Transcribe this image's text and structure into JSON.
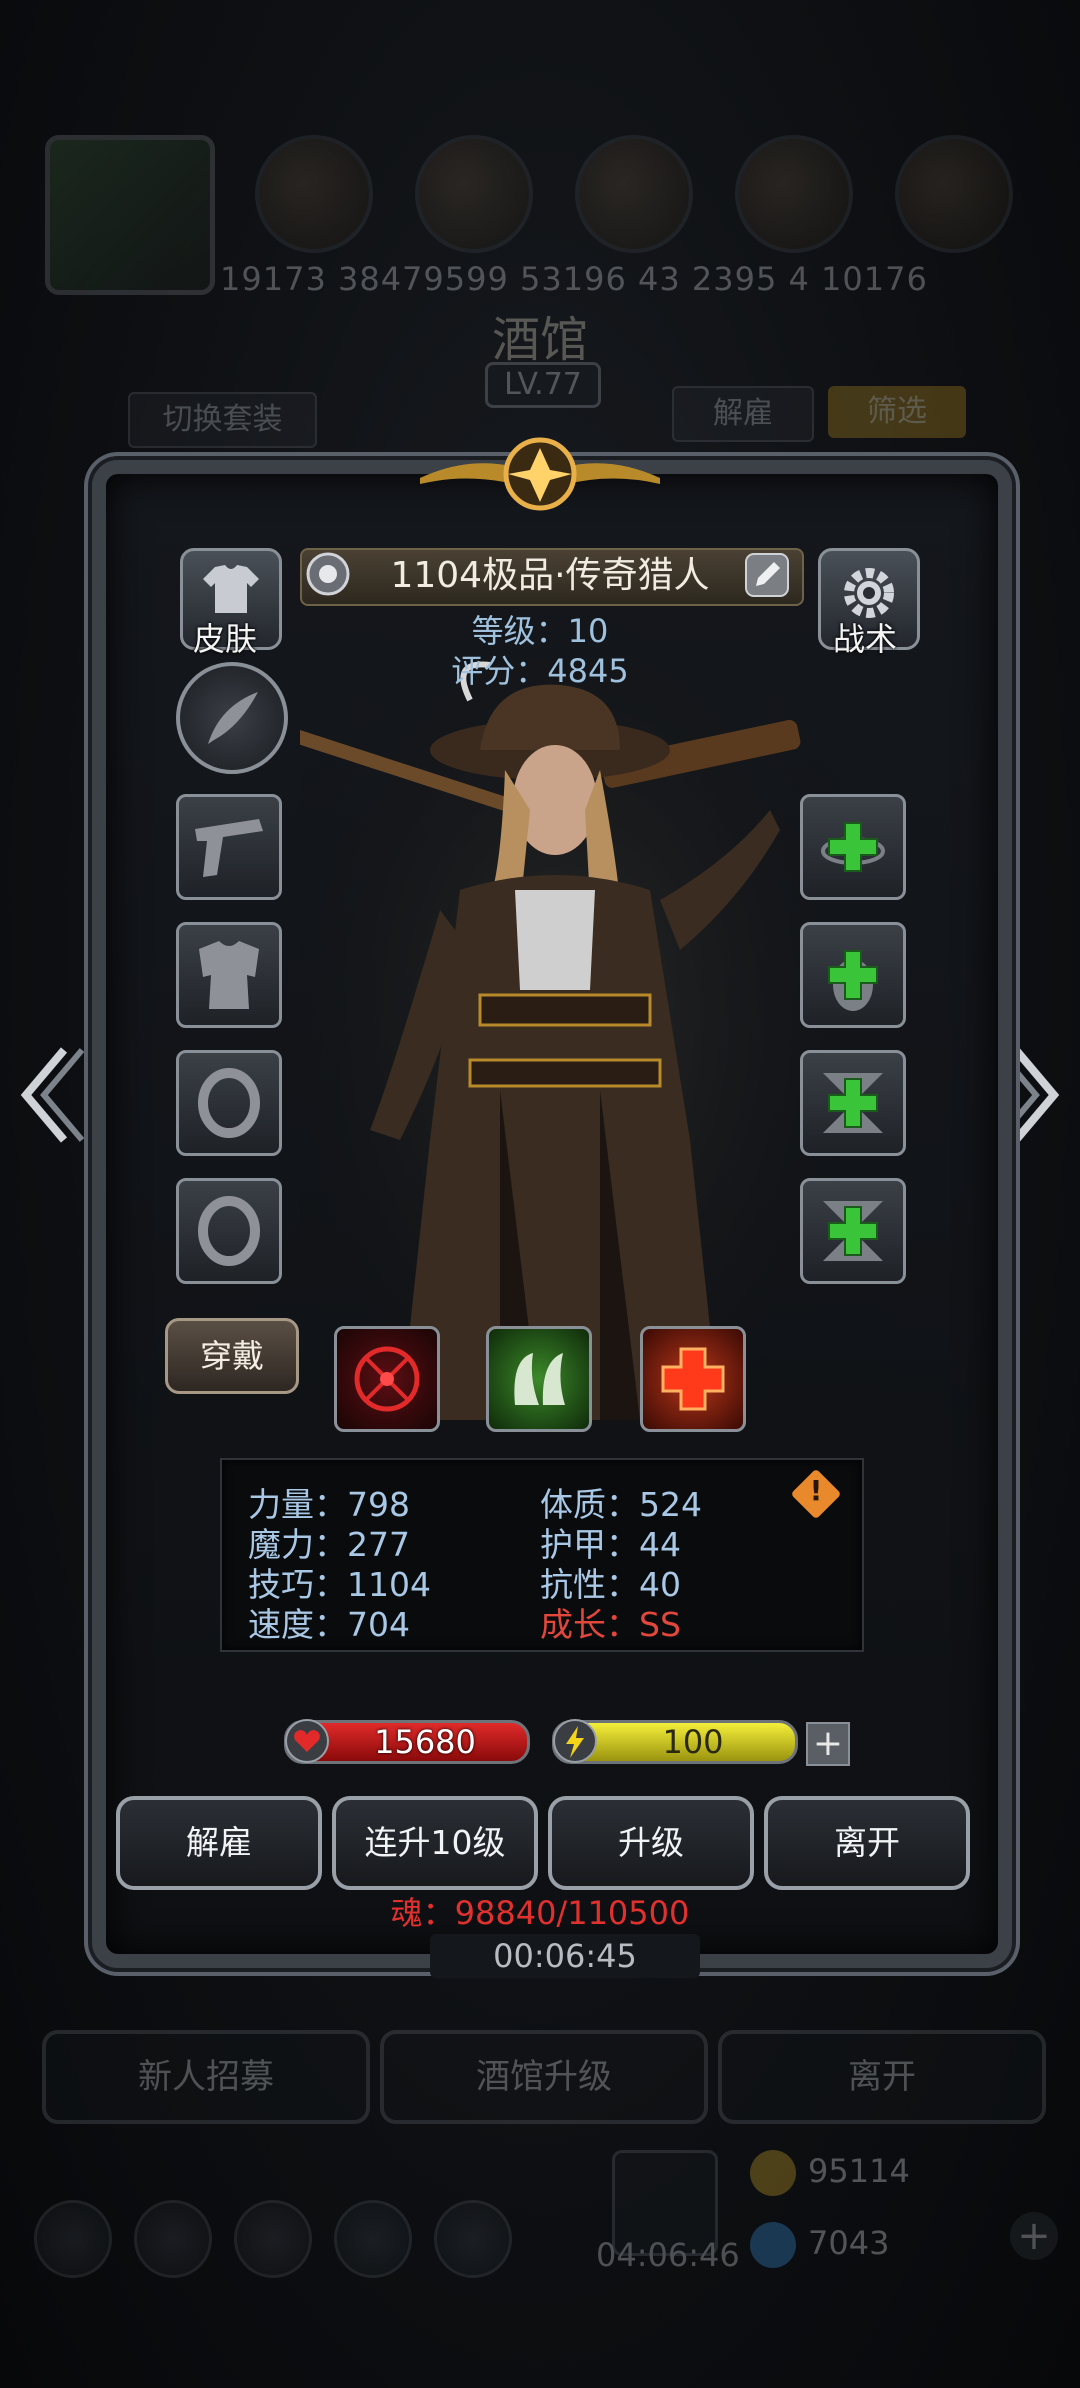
{
  "background": {
    "top_numbers": "19173 38479599 53196 43 2395 4 10176",
    "title": "酒馆",
    "level": "LV.77",
    "switch_outfit_label": "切换套装",
    "dismiss_top_label": "解雇",
    "filter_label": "筛选",
    "timer": "00:06:45",
    "bottom_menu": [
      "新人招募",
      "酒馆升级",
      "离开"
    ],
    "global_timer": "04:06:46",
    "gold": "95114",
    "gems": "7043"
  },
  "hero": {
    "name": "1104极品·传奇猎人",
    "level_label": "等级：10",
    "score_label": "评分：4845",
    "skin_label": "皮肤",
    "tactics_label": "战术",
    "wear_label": "穿戴"
  },
  "stats": [
    {
      "label": "力量：798",
      "highlight": false
    },
    {
      "label": "体质：524",
      "highlight": false
    },
    {
      "label": "魔力：277",
      "highlight": false
    },
    {
      "label": "护甲：44",
      "highlight": false
    },
    {
      "label": "技巧：1104",
      "highlight": false
    },
    {
      "label": "抗性：40",
      "highlight": false
    },
    {
      "label": "速度：704",
      "highlight": false
    },
    {
      "label": "成长：SS",
      "highlight": true
    }
  ],
  "bars": {
    "hp": "15680",
    "energy": "100",
    "energy_add": "+"
  },
  "actions": {
    "dismiss": "解雇",
    "level_up_10": "连升10级",
    "level_up": "升级",
    "leave": "离开"
  },
  "soul": "魂：98840/110500",
  "colors": {
    "hp_bar": "#c4161c",
    "energy_bar": "#d8d21e",
    "stat_text": "#a9c8e6",
    "highlight_text": "#e1473b",
    "soul_text": "#e0312f"
  },
  "icons": {
    "equipment": [
      "quill-icon",
      "pistol-icon",
      "armor-icon",
      "ring-icon",
      "ring-icon"
    ],
    "skills": [
      "plus-icon",
      "plus-icon",
      "plus-icon",
      "plus-icon"
    ],
    "abilities": [
      "target-icon",
      "claw-icon",
      "cross-icon"
    ]
  }
}
